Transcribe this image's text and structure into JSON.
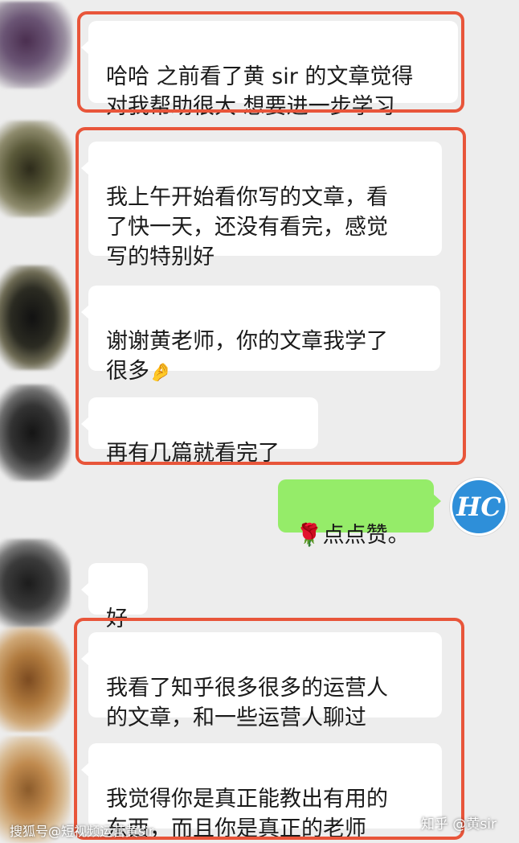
{
  "messages": [
    {
      "side": "in",
      "text": "哈哈 之前看了黄 sir 的文章觉得\n对我帮助很大 想要进一步学习"
    },
    {
      "side": "in",
      "text": "我上午开始看你写的文章，看\n了快一天，还没有看完，感觉\n写的特别好"
    },
    {
      "side": "in",
      "text": "谢谢黄老师，你的文章我学了\n很多",
      "emoji": "🤌"
    },
    {
      "side": "in",
      "text": "再有几篇就看完了"
    },
    {
      "side": "out",
      "rose": "🌹",
      "text": "点点赞。"
    },
    {
      "side": "in",
      "text": "好"
    },
    {
      "side": "in",
      "text": "我看了知乎很多很多的运营人\n的文章，和一些运营人聊过"
    },
    {
      "side": "in",
      "text": "我觉得你是真正能教出有用的\n东西，而且你是真正的老师"
    }
  ],
  "self_avatar": {
    "initials": "HC",
    "color": "#2e8fd9"
  },
  "highlight_color": "#e8553a",
  "watermarks": {
    "left": "搜狐号@短视频运营黄sir",
    "right": "知乎 @黄sir"
  }
}
